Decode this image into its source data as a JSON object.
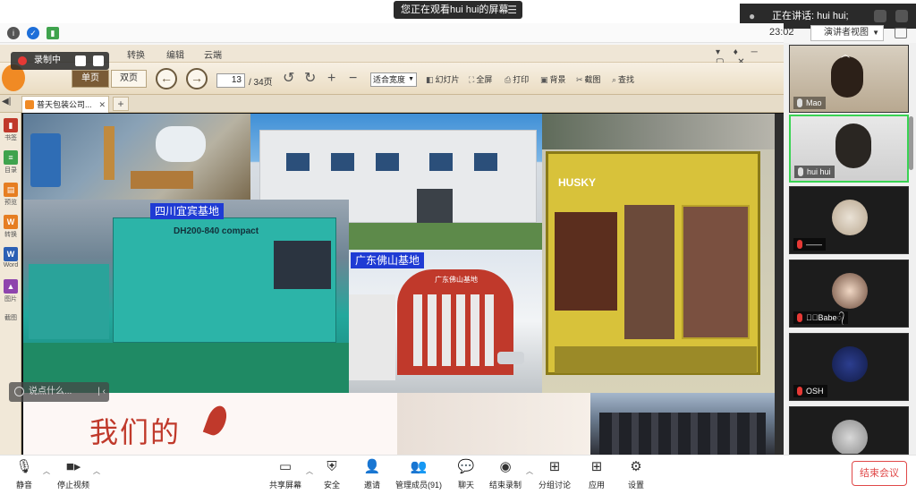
{
  "window": {
    "share_notice": "您正在观看hui hui的屏幕",
    "speaking_label": "正在讲话: hui hui;",
    "time": "23:02",
    "view_mode": "演讲者视图"
  },
  "viewer": {
    "recording_label": "录制中",
    "menu": [
      "转换",
      "编辑",
      "云端"
    ],
    "toolbar": {
      "single_page": "单页",
      "double_page": "双页",
      "page_current": "13",
      "page_total": "/ 34页",
      "fit_mode": "适合宽度",
      "tools": [
        "幻灯片",
        "全屏",
        "打印",
        "背景",
        "截图",
        "查找"
      ]
    },
    "tab": {
      "title": "普天包装公司..."
    },
    "sidebar": [
      "书签",
      "目录",
      "预览",
      "转换",
      "Word",
      "图片",
      "截图"
    ],
    "slide": {
      "tag_sichuan": "四川宜宾基地",
      "tag_guangdong": "广东佛山基地",
      "title": "我们的",
      "machine_text_1": "DH200-840 compact",
      "machine_brand": "HUSKY",
      "building_sign": "广东佛山基地"
    },
    "chat_placeholder": "说点什么..."
  },
  "participants": [
    {
      "name": "Mao",
      "muted": false,
      "active": false
    },
    {
      "name": "hui hui",
      "muted": false,
      "active": true
    },
    {
      "name": "——",
      "muted": true,
      "active": false
    },
    {
      "name": "ℳ᭄Babe᭄",
      "muted": true,
      "active": false
    },
    {
      "name": "OSH",
      "muted": true,
      "active": false
    },
    {
      "name": "",
      "muted": true,
      "active": false
    }
  ],
  "bottombar": {
    "items": [
      {
        "label": "静音",
        "icon": "mic-icon"
      },
      {
        "label": "停止视频",
        "icon": "video-icon"
      },
      {
        "label": "共享屏幕",
        "icon": "share-screen-icon"
      },
      {
        "label": "安全",
        "icon": "shield-icon"
      },
      {
        "label": "邀请",
        "icon": "invite-icon"
      },
      {
        "label": "管理成员(91)",
        "icon": "members-icon"
      },
      {
        "label": "聊天",
        "icon": "chat-icon"
      },
      {
        "label": "结束录制",
        "icon": "stop-record-icon"
      },
      {
        "label": "分组讨论",
        "icon": "breakout-icon"
      },
      {
        "label": "应用",
        "icon": "apps-icon"
      },
      {
        "label": "设置",
        "icon": "gear-icon"
      }
    ],
    "end_meeting": "结束会议"
  },
  "colors": {
    "tag_blue": "#1f3bd4",
    "record_red": "#e53935",
    "active_green": "#39d353",
    "end_red": "#e04848",
    "title_red": "#c0392b"
  }
}
